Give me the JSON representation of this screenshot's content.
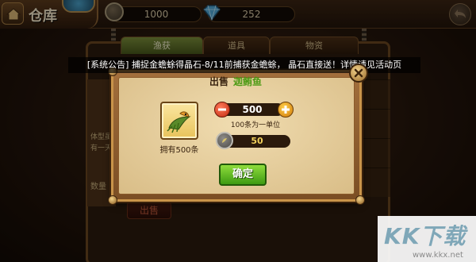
{
  "header": {
    "title": "仓库",
    "coins": "1000",
    "gems": "252"
  },
  "tabs": [
    {
      "label": "渔获",
      "active": true
    },
    {
      "label": "道具",
      "active": false
    },
    {
      "label": "物资",
      "active": false
    }
  ],
  "background_panel": {
    "description": "体型虽 有一天",
    "quantity_label": "数量",
    "sell_button": "出售"
  },
  "announcement": "[系统公告] 捕捉金蟾蜍得晶石-8/11前捕获金蟾蜍， 晶石直接送！详情请见活动页",
  "dialog": {
    "sell_label": "出售",
    "item_name": "迦鲔鱼",
    "owned_count": "拥有500条",
    "quantity": "500",
    "unit_hint": "100条为一单位",
    "price": "50",
    "confirm_label": "确定"
  },
  "watermark": {
    "text": "KK下载",
    "url": "www.kkx.net"
  },
  "colors": {
    "item_name": "#4c9a14",
    "confirm": "#3d9a12",
    "price": "#f2d15c"
  },
  "icons": [
    "home-icon",
    "avatar-badge",
    "coin-icon",
    "gem-icon",
    "back-icon",
    "close-icon",
    "minus-icon",
    "plus-icon",
    "fish-item-icon",
    "silver-coin-icon"
  ]
}
